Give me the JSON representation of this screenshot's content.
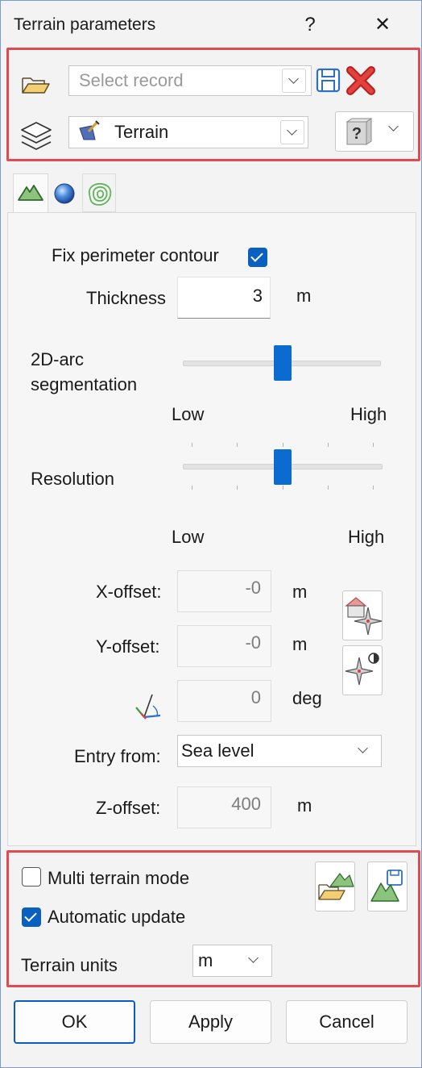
{
  "window": {
    "title": "Terrain parameters",
    "help_glyph": "?",
    "close_glyph": "✕"
  },
  "record": {
    "placeholder": "Select record"
  },
  "layer": {
    "value": "Terrain"
  },
  "help_button": {
    "glyph": "?"
  },
  "tabs": [
    {
      "name": "terrain-tab",
      "icon": "mountain-icon",
      "selected": true
    },
    {
      "name": "sphere-tab",
      "icon": "sphere-icon",
      "selected": false
    },
    {
      "name": "contour-tab",
      "icon": "contour-lines-icon",
      "selected": false
    }
  ],
  "params": {
    "fix_perimeter_label": "Fix perimeter contour",
    "fix_perimeter_checked": true,
    "thickness_label": "Thickness",
    "thickness_value": "3",
    "thickness_unit": "m",
    "arc_label_line1": "2D-arc",
    "arc_label_line2": "segmentation",
    "arc_low": "Low",
    "arc_high": "High",
    "arc_level": 0.5,
    "resolution_label": "Resolution",
    "resolution_low": "Low",
    "resolution_high": "High",
    "resolution_level": 0.5,
    "xoffset_label": "X-offset:",
    "xoffset_value": "-0",
    "xoffset_unit": "m",
    "yoffset_label": "Y-offset:",
    "yoffset_value": "-0",
    "yoffset_unit": "m",
    "angle_value": "0",
    "angle_unit": "deg",
    "entry_label": "Entry from:",
    "entry_value": "Sea level",
    "zoffset_label": "Z-offset:",
    "zoffset_value": "400",
    "zoffset_unit": "m"
  },
  "bottom": {
    "multi_label": "Multi terrain mode",
    "multi_checked": false,
    "auto_label": "Automatic update",
    "auto_checked": true,
    "units_label": "Terrain units",
    "units_value": "m"
  },
  "buttons": {
    "ok": "OK",
    "apply": "Apply",
    "cancel": "Cancel"
  },
  "colors": {
    "highlight_border": "#e04a52",
    "accent": "#0a6cd0"
  }
}
